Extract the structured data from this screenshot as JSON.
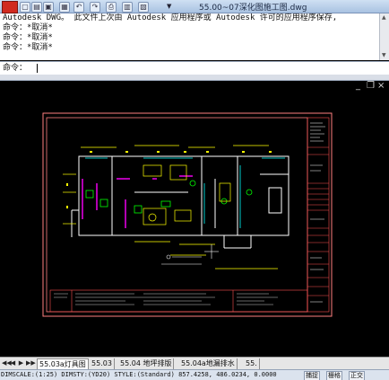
{
  "window": {
    "title": "55.00~07深化图施工图.dwg"
  },
  "quick_access": [
    {
      "name": "new-icon",
      "glyph": "▢"
    },
    {
      "name": "open-icon",
      "glyph": "▤"
    },
    {
      "name": "save-icon",
      "glyph": "▣"
    },
    {
      "name": "saveas-icon",
      "glyph": "▦"
    },
    {
      "name": "undo-icon",
      "glyph": "↶"
    },
    {
      "name": "redo-icon",
      "glyph": "↷"
    },
    {
      "name": "plot-icon",
      "glyph": "⎙"
    },
    {
      "name": "publish-icon",
      "glyph": "▥"
    },
    {
      "name": "properties-icon",
      "glyph": "▧"
    }
  ],
  "command_history": [
    "Autodesk DWG。  此文件上次由 Autodesk 应用程序或 Autodesk 许可的应用程序保存,",
    "命令：*取消*",
    "命令：*取消*",
    "命令：*取消*"
  ],
  "command_line": {
    "prompt": "命令："
  },
  "viewport_controls": {
    "minimize": "_",
    "restore": "❐",
    "close": "×"
  },
  "layout_tabs": {
    "nav": [
      "◀◀",
      "◀",
      "▶",
      "▶▶"
    ],
    "tabs": [
      "55.03a灯具图",
      "55.03",
      "55.04 地坪排版",
      "55.04a地漏排水",
      "55."
    ],
    "active_index": 0
  },
  "status_bar": {
    "text": "DIMSCALE:(1:25) DIMSTY:(YD20) STYLE:(Standard)  857.4258,  486.0234,  0.0000",
    "buttons": [
      "捕捉",
      "栅格",
      "正交"
    ]
  },
  "colors": {
    "sheet_border": "#ff8080",
    "wall": "#ffffff",
    "furniture": "#ffff00",
    "partition": "#ff00ff",
    "fixture": "#00ff00",
    "glass": "#00ffff",
    "annotation": "#ffff00",
    "title_block": "#ff4040"
  }
}
